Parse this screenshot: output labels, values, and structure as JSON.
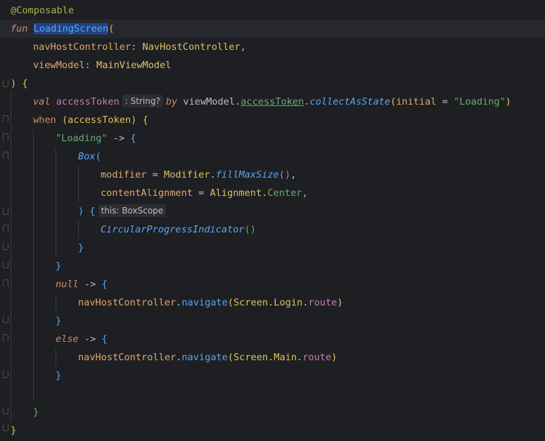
{
  "editor": {
    "language": "Kotlin",
    "annotation": "@Composable",
    "fun_keyword": "fun",
    "function_name": "LoadingScreen",
    "open_paren": "(",
    "param1_name": "navHostController",
    "param1_sep": ": ",
    "param1_type": "NavHostController",
    "param1_comma": ",",
    "param2_name": "viewModel",
    "param2_sep": ": ",
    "param2_type": "MainViewModel",
    "sig_close": ") {",
    "val_keyword": "val",
    "access_token_var": "accessToken",
    "type_hint": ": String?",
    "by_keyword": "by",
    "view_model_ref": "viewModel",
    "dot": ".",
    "access_token_prop": "accessToken",
    "collect_call": "collectAsState",
    "initial_param": "initial",
    "equals": " = ",
    "loading_string": "\"Loading\"",
    "close_paren": ")",
    "when_keyword": "when",
    "when_subject": "(accessToken)",
    "when_brace": "{",
    "arrow": " -> ",
    "brace_open": "{",
    "brace_close": "}",
    "box_call": "Box",
    "modifier_param": "modifier",
    "modifier_obj": "Modifier",
    "fill_max_size": "fillMaxSize",
    "empty_parens": "()",
    "comma": ",",
    "content_alignment_param": "contentAlignment",
    "alignment_obj": "Alignment",
    "center_value": "Center",
    "paren_brace": ") {",
    "scope_hint": "this: BoxScope",
    "progress_indicator": "CircularProgressIndicator",
    "null_keyword": "null",
    "else_keyword": "else",
    "nav_host_ref": "navHostController",
    "navigate_call": "navigate",
    "screen_obj": "Screen",
    "login_obj": "Login",
    "main_obj": "Main",
    "route_prop": "route"
  },
  "colors": {
    "background": "#1e1f22",
    "keyword": "#cf8e6d",
    "function": "#56a8f5",
    "string": "#6aab73",
    "parameter": "#e0a96d",
    "type": "#e0c15f",
    "property": "#c77dbb"
  }
}
